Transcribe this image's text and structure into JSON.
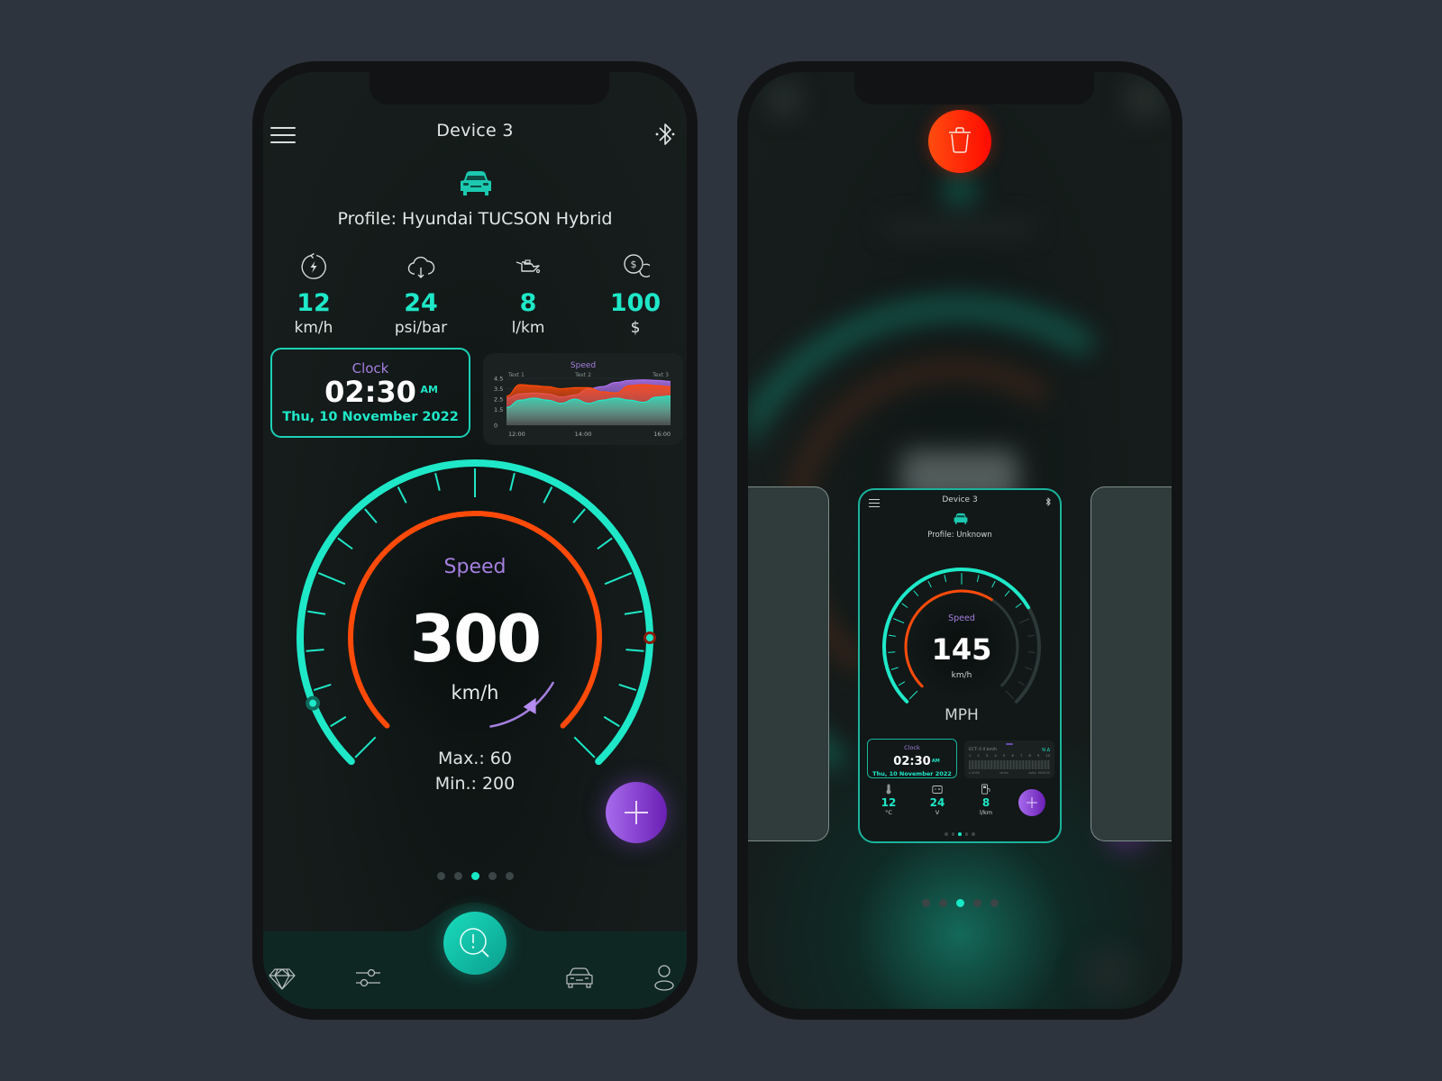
{
  "colors": {
    "accent": "#1ee8c8",
    "danger": "#ff3a06",
    "gauge_inner": "#ff4a0a",
    "purple": "#a57fe0",
    "background": "#2e343d"
  },
  "left_phone": {
    "header": {
      "menu_icon": "hamburger-menu-icon",
      "title": "Device 3",
      "bluetooth_icon": "bluetooth-icon"
    },
    "profile": {
      "icon": "car-icon",
      "text": "Profile: Hyundai TUCSON Hybrid"
    },
    "stats": [
      {
        "icon": "energy-icon",
        "value": "12",
        "unit": "km/h"
      },
      {
        "icon": "cloud-download-icon",
        "value": "24",
        "unit": "psi/bar"
      },
      {
        "icon": "oil-can-icon",
        "value": "8",
        "unit": "l/km"
      },
      {
        "icon": "coins-icon",
        "value": "100",
        "unit": "$"
      }
    ],
    "clock": {
      "label": "Clock",
      "time": "02:30",
      "ampm": "AM",
      "date": "Thu, 10 November 2022"
    },
    "speed_chart": {
      "chart_data": {
        "type": "area",
        "title": "Speed",
        "annotations": [
          "Text 1",
          "Text 2",
          "Text 3"
        ],
        "x_ticks": [
          "12:00",
          "14:00",
          "16:00"
        ],
        "y_ticks": [
          "0",
          "1.5",
          "2.5",
          "3.5",
          "4.5"
        ],
        "ylim": [
          0,
          4.5
        ],
        "x": [
          0,
          1,
          2,
          3,
          4,
          5,
          6,
          7,
          8,
          9,
          10,
          11,
          12
        ],
        "series": [
          {
            "name": "purple",
            "color": "#b072f0",
            "values": [
              2.6,
              3.0,
              3.1,
              3.0,
              2.7,
              2.9,
              3.5,
              3.7,
              4.1,
              4.3,
              4.35,
              4.3,
              4.2
            ]
          },
          {
            "name": "orange",
            "color": "#ff4a0a",
            "values": [
              2.8,
              3.9,
              3.8,
              3.7,
              3.5,
              3.6,
              3.6,
              3.2,
              3.1,
              3.8,
              3.9,
              3.8,
              3.7
            ]
          },
          {
            "name": "teal",
            "color": "#1ee8c8",
            "values": [
              1.7,
              2.4,
              2.6,
              2.4,
              2.1,
              2.5,
              2.1,
              2.4,
              2.6,
              2.4,
              2.2,
              2.7,
              2.8
            ]
          }
        ]
      }
    },
    "gauge": {
      "label": "Speed",
      "value": "300",
      "unit": "km/h",
      "max_label": "Max.: 60",
      "min_label": "Min.: 200",
      "fill_fraction": 1.0,
      "inner_fraction": 1.0,
      "tick_count": 21
    },
    "fab": {
      "icon": "plus-icon"
    },
    "pagination": {
      "count": 5,
      "active": 2
    },
    "navbar": {
      "items": [
        {
          "icon": "diamond-icon",
          "name": "premium"
        },
        {
          "icon": "sliders-icon",
          "name": "settings"
        },
        {
          "icon": "diagnostics-search-icon",
          "name": "diagnostics"
        },
        {
          "icon": "car-icon",
          "name": "vehicles"
        },
        {
          "icon": "user-icon",
          "name": "profile"
        }
      ]
    }
  },
  "right_phone": {
    "delete_button": {
      "icon": "trash-icon"
    },
    "mini_card": {
      "title": "Device 3",
      "profile": "Profile: Unknown",
      "gauge": {
        "label": "Speed",
        "value": "145",
        "unit": "km/h",
        "mode": "MPH",
        "fill_fraction": 0.72,
        "inner_fraction": 0.62
      },
      "clock": {
        "label": "Clock",
        "time": "02:30",
        "ampm": "AM",
        "date": "Thu, 10 November 2022"
      },
      "ect_panel": {
        "row": "ECT: 0   0 km/h",
        "status": "N Δ",
        "numbers": [
          "1",
          "2",
          "3",
          "4",
          "5",
          "6",
          "7",
          "8",
          "9",
          "10"
        ],
        "footer": [
          "x 0000",
          "ctrlvs",
          "volts: 000000"
        ]
      },
      "stats": [
        {
          "icon": "thermometer-icon",
          "value": "12",
          "unit": "°C"
        },
        {
          "icon": "battery-icon",
          "value": "24",
          "unit": "V"
        },
        {
          "icon": "fuel-pump-icon",
          "value": "8",
          "unit": "l/km"
        }
      ],
      "pagination": {
        "count": 5,
        "active": 2
      }
    },
    "pagination": {
      "count": 5,
      "active": 2
    }
  }
}
